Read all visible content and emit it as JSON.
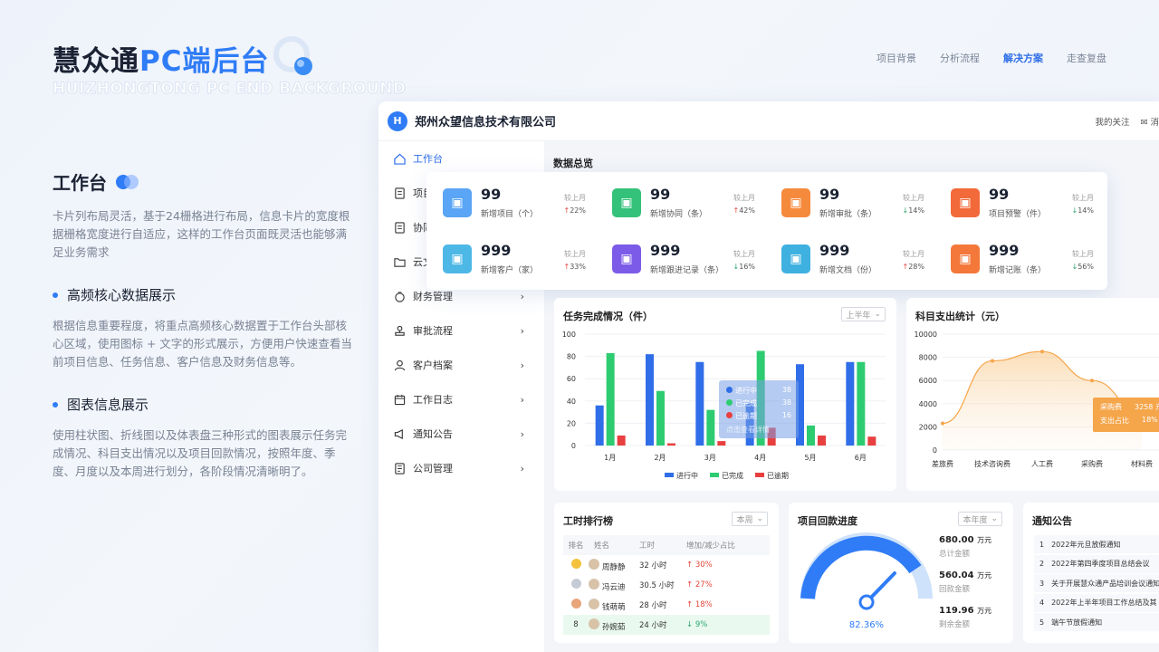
{
  "hero": {
    "title_prefix": "慧众通",
    "title_accent": "PC端后台",
    "subtitle": "HUIZHONGTONG PC END BACKGROUND"
  },
  "topnav": [
    "项目背景",
    "分析流程",
    "解决方案",
    "走查复盘"
  ],
  "topnav_active": 2,
  "left": {
    "heading": "工作台",
    "intro": "卡片列布局灵活，基于24栅格进行布局，信息卡片的宽度根据栅格宽度进行自适应，这样的工作台页面既灵活也能够满足业务需求",
    "s1_title": "高频核心数据展示",
    "s1_text": "根据信息重要程度，将重点高频核心数据置于工作台头部核心区域，使用图标 + 文字的形式展示，方便用户快速查看当前项目信息、任务信息、客户信息及财务信息等。",
    "s2_title": "图表信息展示",
    "s2_text": "使用柱状图、折线图以及体表盘三种形式的图表展示任务完成情况、科目支出情况以及项目回款情况，按照年度、季度、月度以及本周进行划分，各阶段情况清晰明了。"
  },
  "app": {
    "logo": "H",
    "company": "郑州众望信息技术有限公司",
    "header_links": [
      "我的关注",
      "消"
    ],
    "sidebar": [
      "工作台",
      "项目",
      "协同",
      "云文",
      "财务管理",
      "审批流程",
      "客户档案",
      "工作日志",
      "通知公告",
      "公司管理"
    ],
    "data_title": "数据总览",
    "stats": [
      {
        "num": "99",
        "label": "新增项目（个）",
        "cmp": "较上月",
        "pct": "22%",
        "dir": "up",
        "color": "#5aa5f5",
        "icon": "clipboard-icon"
      },
      {
        "num": "99",
        "label": "新增协同（条）",
        "cmp": "较上月",
        "pct": "42%",
        "dir": "up",
        "color": "#34c27a",
        "icon": "check-icon"
      },
      {
        "num": "99",
        "label": "新增审批（条）",
        "cmp": "较上月",
        "pct": "14%",
        "dir": "down",
        "color": "#f58a3d",
        "icon": "stamp-icon"
      },
      {
        "num": "99",
        "label": "项目预警（件）",
        "cmp": "较上月",
        "pct": "14%",
        "dir": "down",
        "color": "#f26a3a",
        "icon": "bell-icon"
      },
      {
        "num": "999",
        "label": "新增客户（家）",
        "cmp": "较上月",
        "pct": "33%",
        "dir": "up",
        "color": "#4db8e6",
        "icon": "user-icon"
      },
      {
        "num": "999",
        "label": "新增跟进记录（条）",
        "cmp": "较上月",
        "pct": "16%",
        "dir": "down",
        "color": "#7b5be8",
        "icon": "doc-icon"
      },
      {
        "num": "999",
        "label": "新增文档（份）",
        "cmp": "较上月",
        "pct": "28%",
        "dir": "up",
        "color": "#3fb1e0",
        "icon": "folder-icon"
      },
      {
        "num": "999",
        "label": "新增记账（条）",
        "cmp": "较上月",
        "pct": "56%",
        "dir": "down",
        "color": "#f3783a",
        "icon": "money-bag-icon"
      }
    ],
    "task_title": "任务完成情况（件）",
    "task_select": "上半年",
    "tooltip": {
      "rows": [
        "进行中",
        "已完成",
        "已逾期"
      ],
      "vals": [
        "38",
        "38",
        "16"
      ],
      "footer": "点击查看详情"
    },
    "expense_title": "科目支出统计（元）",
    "expense_tooltip": {
      "r1_label": "采购费",
      "r1_val": "3258 元",
      "r2_label": "支出占比",
      "r2_val": "18%"
    },
    "rank_title": "工时排行榜",
    "rank_select": "本周",
    "rank_head": [
      "排名",
      "姓名",
      "工时",
      "增加/减少占比"
    ],
    "rank_rows": [
      {
        "rank": "",
        "name": "周静静",
        "hours": "32 小时",
        "pct": "30%",
        "dir": "up",
        "medal": "#f3c23a"
      },
      {
        "rank": "",
        "name": "冯云迪",
        "hours": "30.5 小时",
        "pct": "27%",
        "dir": "up",
        "medal": "#c4cbd6"
      },
      {
        "rank": "",
        "name": "钱萌萌",
        "hours": "28 小时",
        "pct": "18%",
        "dir": "up",
        "medal": "#e9a57a"
      },
      {
        "rank": "8",
        "name": "孙婉茹",
        "hours": "24 小时",
        "pct": "9%",
        "dir": "down",
        "medal": ""
      }
    ],
    "payback_title": "项目回款进度",
    "payback_select": "本年度",
    "payback_pct": "82.36%",
    "payback_amounts": [
      {
        "value": "680.00",
        "unit": "万元",
        "label": "总计金额"
      },
      {
        "value": "560.04",
        "unit": "万元",
        "label": "回款金额"
      },
      {
        "value": "119.96",
        "unit": "万元",
        "label": "剩余金额"
      }
    ],
    "notice_title": "通知公告",
    "notices": [
      "2022年元旦放假通知",
      "2022年第四季度项目总结会议",
      "关于开展慧众通产品培训会议通知",
      "2022年上半年项目工作总结及其",
      "端午节放假通知"
    ]
  },
  "chart_data": [
    {
      "type": "bar",
      "title": "任务完成情况（件）",
      "categories": [
        "1月",
        "2月",
        "3月",
        "4月",
        "5月",
        "6月"
      ],
      "series": [
        {
          "name": "进行中",
          "values": [
            36,
            82,
            75,
            38,
            73,
            75
          ],
          "color": "#2f6ee8"
        },
        {
          "name": "已完成",
          "values": [
            83,
            49,
            32,
            85,
            18,
            75
          ],
          "color": "#2ecc71"
        },
        {
          "name": "已逾期",
          "values": [
            9,
            2,
            4,
            16,
            9,
            8
          ],
          "color": "#e84040"
        }
      ],
      "ylim": [
        0,
        100
      ],
      "yticks": [
        0,
        20,
        40,
        60,
        80,
        100
      ],
      "legend": "bottom"
    },
    {
      "type": "area",
      "title": "科目支出统计（元）",
      "categories": [
        "差旅费",
        "技术咨询费",
        "人工费",
        "采购费",
        "材料费"
      ],
      "values": [
        2300,
        7700,
        8500,
        6000,
        3258
      ],
      "ylim": [
        0,
        10000
      ],
      "yticks": [
        0,
        2000,
        4000,
        6000,
        8000,
        10000
      ],
      "color": "#f5a54a"
    }
  ]
}
